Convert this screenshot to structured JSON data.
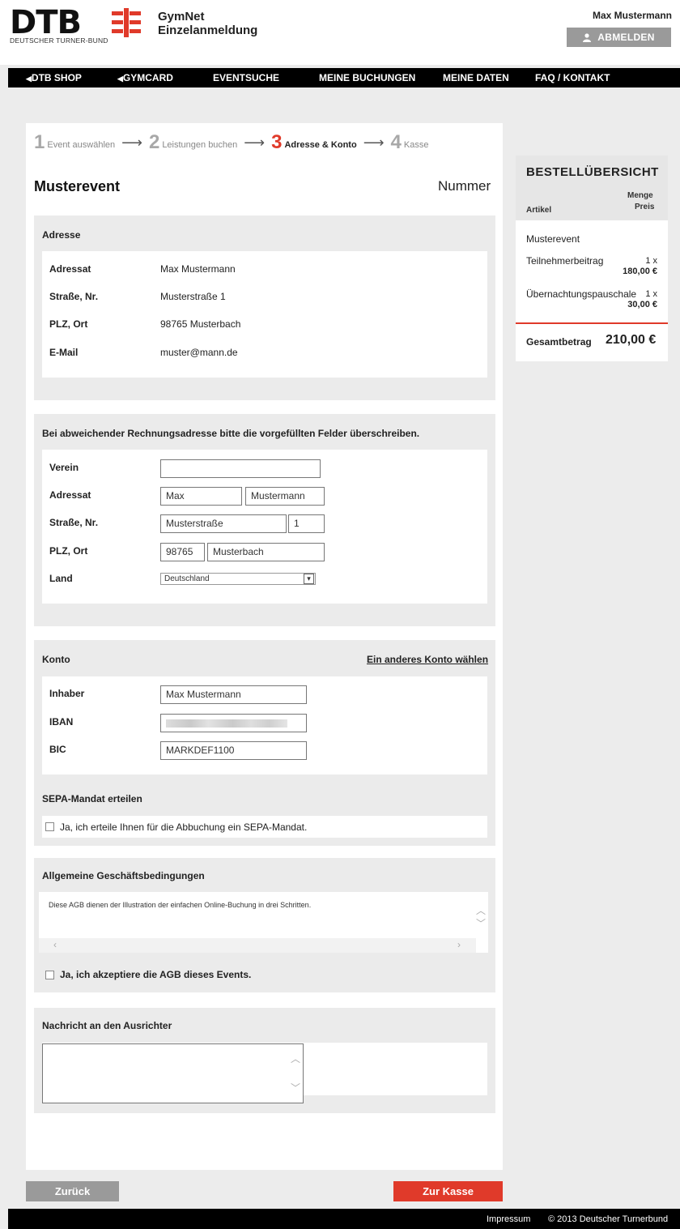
{
  "header": {
    "logo_main": "DTB",
    "logo_sub": "DEUTSCHER TURNER-BUND",
    "app_title_line1": "GymNet",
    "app_title_line2": "Einzelanmeldung",
    "user_name": "Max Mustermann",
    "logout_label": "ABMELDEN"
  },
  "nav": [
    "DTB SHOP",
    "GYMCARD",
    "EVENTSUCHE",
    "MEINE BUCHUNGEN",
    "MEINE DATEN",
    "FAQ / KONTAKT"
  ],
  "steps": [
    {
      "num": "1",
      "label": "Event auswählen",
      "active": false
    },
    {
      "num": "2",
      "label": "Leistungen buchen",
      "active": false
    },
    {
      "num": "3",
      "label": "Adresse & Konto",
      "active": true
    },
    {
      "num": "4",
      "label": "Kasse",
      "active": false
    }
  ],
  "event": {
    "title": "Musterevent",
    "number_label": "Nummer"
  },
  "address": {
    "title": "Adresse",
    "rows": [
      {
        "label": "Adressat",
        "value": "Max Mustermann"
      },
      {
        "label": "Straße, Nr.",
        "value": "Musterstraße 1"
      },
      {
        "label": "PLZ, Ort",
        "value": "98765 Musterbach"
      },
      {
        "label": "E-Mail",
        "value": "muster@mann.de"
      }
    ]
  },
  "billing": {
    "title": "Bei abweichender Rechnungsadresse bitte die vorgefüllten Felder überschreiben.",
    "labels": {
      "club": "Verein",
      "name": "Adressat",
      "street": "Straße, Nr.",
      "zip": "PLZ, Ort",
      "country": "Land"
    },
    "values": {
      "club": "",
      "first": "Max",
      "last": "Mustermann",
      "street": "Musterstraße",
      "house": "1",
      "zip": "98765",
      "city": "Musterbach",
      "country": "Deutschland"
    }
  },
  "account": {
    "title": "Konto",
    "change_link": "Ein anderes Konto wählen",
    "labels": {
      "owner": "Inhaber",
      "iban": "IBAN",
      "bic": "BIC"
    },
    "values": {
      "owner": "Max Mustermann",
      "iban": "",
      "bic": "MARKDEF1100"
    },
    "sepa_title": "SEPA-Mandat erteilen",
    "sepa_checkbox": "Ja, ich erteile Ihnen für die Abbuchung ein SEPA-Mandat."
  },
  "agb": {
    "title": "Allgemeine Geschäftsbedingungen",
    "text": "Diese AGB dienen der Illustration der einfachen Online-Buchung in drei Schritten.",
    "checkbox": "Ja, ich akzeptiere die AGB dieses Events."
  },
  "message": {
    "title": "Nachricht an den Ausrichter",
    "value": ""
  },
  "summary": {
    "title": "BESTELLÜBERSICHT",
    "col_article": "Artikel",
    "col_qty": "Menge",
    "col_price": "Preis",
    "event": "Musterevent",
    "items": [
      {
        "name": "Teilnehmerbeitrag",
        "qty": "1 x",
        "price": "180,00 €"
      },
      {
        "name": "Übernachtungspauschale",
        "qty": "1 x",
        "price": "30,00 €"
      }
    ],
    "total_label": "Gesamtbetrag",
    "total_value": "210,00 €"
  },
  "buttons": {
    "back": "Zurück",
    "checkout": "Zur Kasse"
  },
  "footer": {
    "imprint": "Impressum",
    "copyright": "© 2013 Deutscher Turnerbund"
  },
  "colors": {
    "accent": "#e03a2a",
    "nav_bg": "#000000",
    "button_gray": "#9a9a9a",
    "panel_gray": "#ebebeb"
  }
}
